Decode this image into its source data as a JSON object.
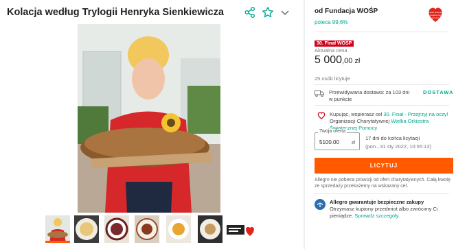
{
  "product": {
    "title": "Kolacja według Trylogii Henryka Sienkiewicza"
  },
  "header_icons": [
    "share-icon",
    "star-icon",
    "chevron-down-icon"
  ],
  "gallery": {
    "thumbnail_count": 7,
    "selected_index": 0
  },
  "seller": {
    "name": "od Fundacja WOŚP",
    "recommend": "poleca 99,6%",
    "logo_text": "wielka orkiestra świątecznej pomocy"
  },
  "auction": {
    "badge": "30. Finał WOŚP",
    "price_label": "Aktualna cena",
    "price_main": "5 000",
    "price_decimals": ",00 zł",
    "bids": "25 osób licytuje"
  },
  "delivery": {
    "text": "Przewidywana dostawa: za 103 dni w punkcie",
    "link": "DOSTAWA"
  },
  "charity": {
    "prefix": "Kupując, wspierasz cel ",
    "goal": "30. Finał - Przejrzyj na oczy!",
    "middle": " Organizacji Charytatywnej ",
    "org": "Wielka Orkiestra Świątecznej Pomocy"
  },
  "offer": {
    "label": "Twoja oferta",
    "value": "5100.00",
    "currency": "zł",
    "ends_in": "17 dni do końca licytacji",
    "ends_at": "(pon., 31 sty 2022, 10:55:13)"
  },
  "bid_button": "LICYTUJ",
  "info_text": "Allegro nie pobiera prowizji od ofert charytatywnych. Całą kwotę ze sprzedaży przekażemy na wskazany cel.",
  "guarantee": {
    "title": "Allegro gwarantuje bezpieczne zakupy",
    "text": "Otrzymasz kupiony przedmiot albo zwrócimy Ci pieniądze. ",
    "link": "Sprawdź szczegóły."
  },
  "colors": {
    "accent": "#ff5a00",
    "teal": "#00a790",
    "badge": "#d0021b"
  }
}
